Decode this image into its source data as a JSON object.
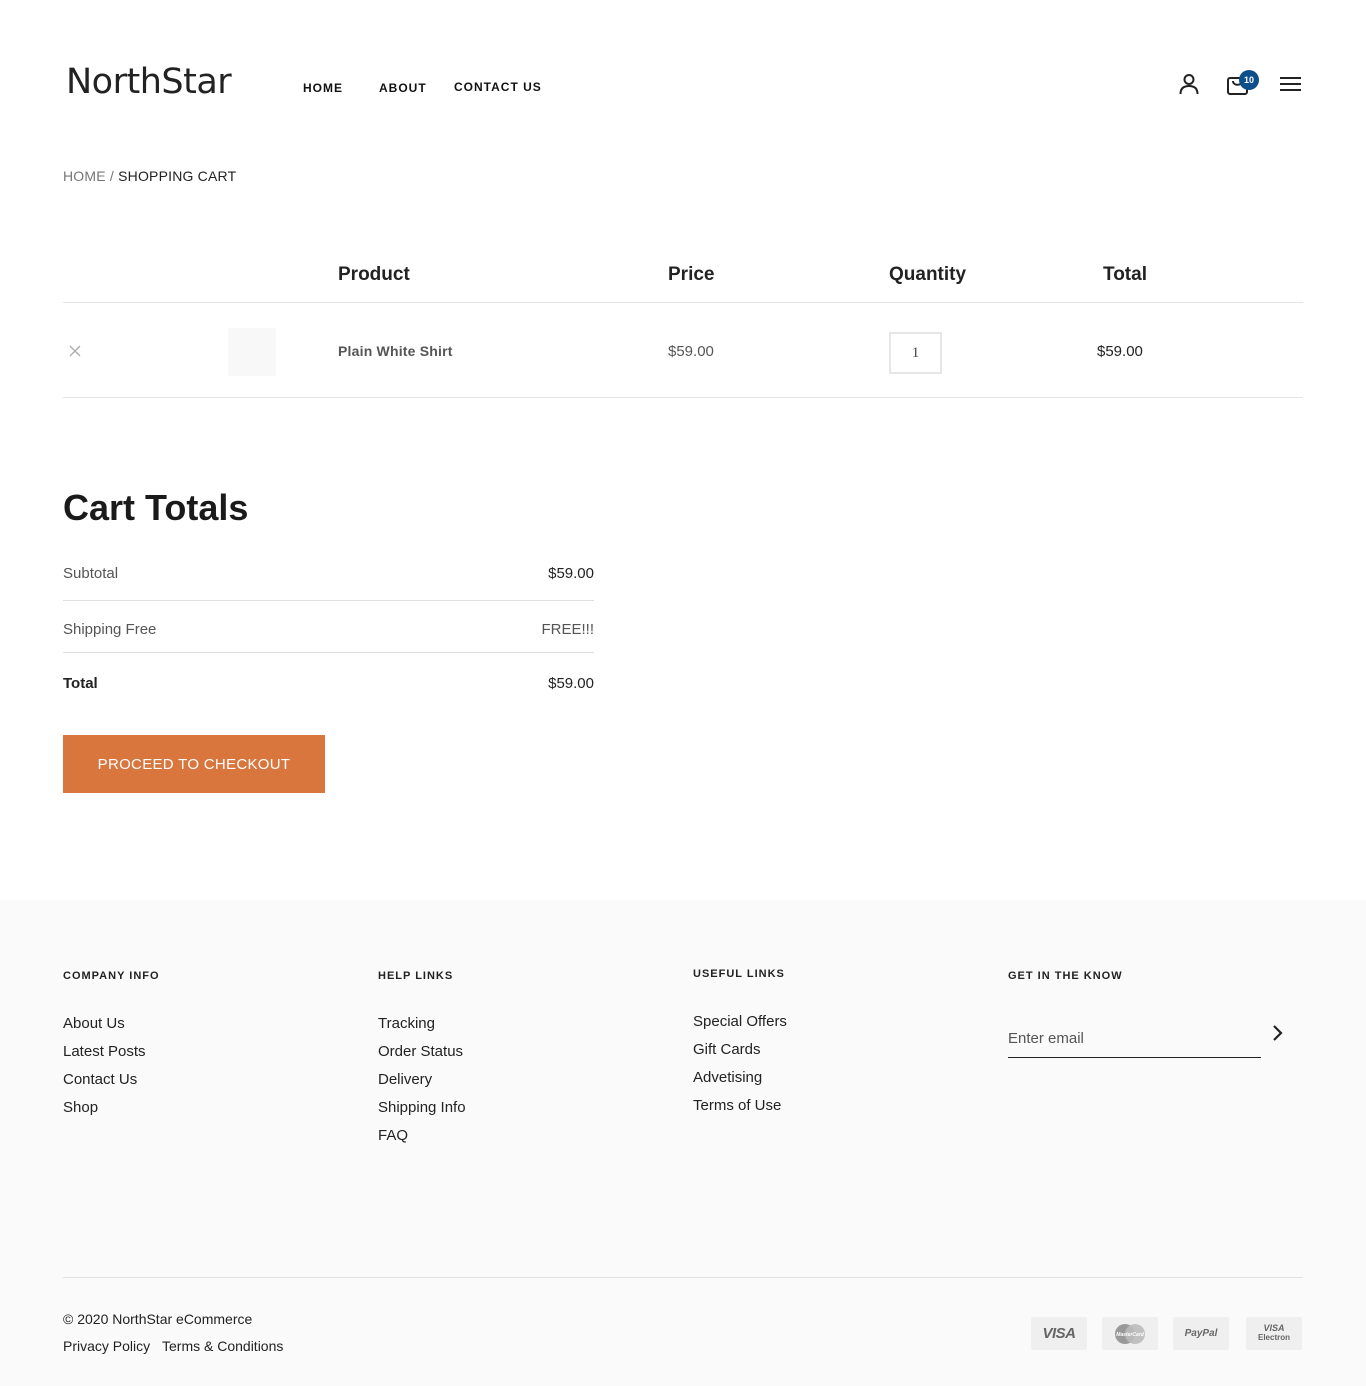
{
  "header": {
    "logo": "NorthStar",
    "nav": [
      {
        "label": "HOME"
      },
      {
        "label": "ABOUT"
      },
      {
        "label": "CONTACT US"
      }
    ],
    "icons": [
      "user-icon",
      "cart-icon",
      "menu-icon"
    ],
    "cart_count": "10",
    "badge_color": "#0d4f8b"
  },
  "breadcrumb": {
    "home": "HOME",
    "separator": " / ",
    "current": "SHOPPING CART"
  },
  "cart": {
    "headers": {
      "product": "Product",
      "price": "Price",
      "quantity": "Quantity",
      "total": "Total"
    },
    "items": [
      {
        "remove_icon": "close-icon",
        "name": "Plain White Shirt",
        "price": "$59.00",
        "quantity": "1",
        "total": "$59.00"
      }
    ]
  },
  "totals": {
    "title": "Cart Totals",
    "subtotal_label": "Subtotal",
    "subtotal_value": "$59.00",
    "shipping_label": "Shipping Free",
    "shipping_value": "FREE!!!",
    "total_label": "Total",
    "total_value": "$59.00",
    "checkout_label": "PROCEED TO CHECKOUT",
    "checkout_color": "#d9763e"
  },
  "footer": {
    "company": {
      "title": "COMPANY INFO",
      "links": [
        "About Us",
        "Latest Posts",
        "Contact Us",
        "Shop"
      ]
    },
    "help": {
      "title": "HELP LINKS",
      "links": [
        "Tracking",
        "Order Status",
        "Delivery",
        "Shipping Info",
        "FAQ"
      ]
    },
    "useful": {
      "title": "USEFUL LINKS",
      "links": [
        "Special Offers",
        "Gift Cards",
        "Advetising",
        "Terms of Use"
      ]
    },
    "newsletter": {
      "title": "GET IN THE KNOW",
      "placeholder": "Enter email",
      "submit_icon": "chevron-right-icon"
    },
    "copyright": "© 2020 NorthStar eCommerce",
    "legal": [
      "Privacy Policy",
      "Terms & Conditions"
    ],
    "payments": [
      {
        "icon": "visa-icon",
        "label": "VISA"
      },
      {
        "icon": "mastercard-icon",
        "label": "MasterCard"
      },
      {
        "icon": "paypal-icon",
        "label": "PayPal"
      },
      {
        "icon": "visa-electron-icon",
        "label": "VISA",
        "sub": "Electron"
      }
    ]
  }
}
